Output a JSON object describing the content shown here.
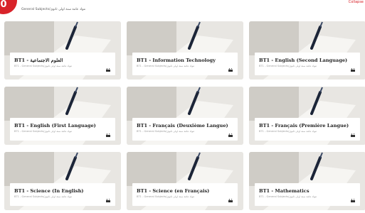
{
  "header": {
    "badge_text": "0",
    "breadcrumb": "General Subjects/مواد عامة سنة اولى ثانوي",
    "collapse_label": "Collapse"
  },
  "courses": [
    {
      "title": "BT1 - العلوم الاجتماعية",
      "subtitle": "BT1 - General Subjects/مواد عامة  سنة اولى ثانوي"
    },
    {
      "title": "BT1 - Information Technology",
      "subtitle": "BT1 - General Subjects/مواد عامة  سنة اولى ثانوي"
    },
    {
      "title": "BT1 - English (Second Language)",
      "subtitle": "BT1 - General Subjects/مواد عامة  سنة اولى ثانوي"
    },
    {
      "title": "BT1 - English (First Language)",
      "subtitle": "BT1 - General Subjects/مواد عامة  سنة اولى ثانوي"
    },
    {
      "title": "BT1 - Français (Deuxième Langue)",
      "subtitle": "BT1 - General Subjects/مواد عامة  سنة اولى ثانوي"
    },
    {
      "title": "BT1 - Français (Première Langue)",
      "subtitle": "BT1 - General Subjects/مواد عامة  سنة اولى ثانوي"
    },
    {
      "title": "BT1 - Science (In English)",
      "subtitle": "BT1 - General Subjects/مواد عامة  سنة اولى ثانوي"
    },
    {
      "title": "BT1 - Science (en Français)",
      "subtitle": "BT1 - General Subjects/مواد عامة  سنة اولى ثانوي"
    },
    {
      "title": "BT1 - Mathematics",
      "subtitle": "BT1 - General Subjects/مواد عامة  سنة اولى ثانوي"
    }
  ],
  "icons": {
    "lock": "lock-icon"
  },
  "colors": {
    "accent": "#d8232a"
  }
}
